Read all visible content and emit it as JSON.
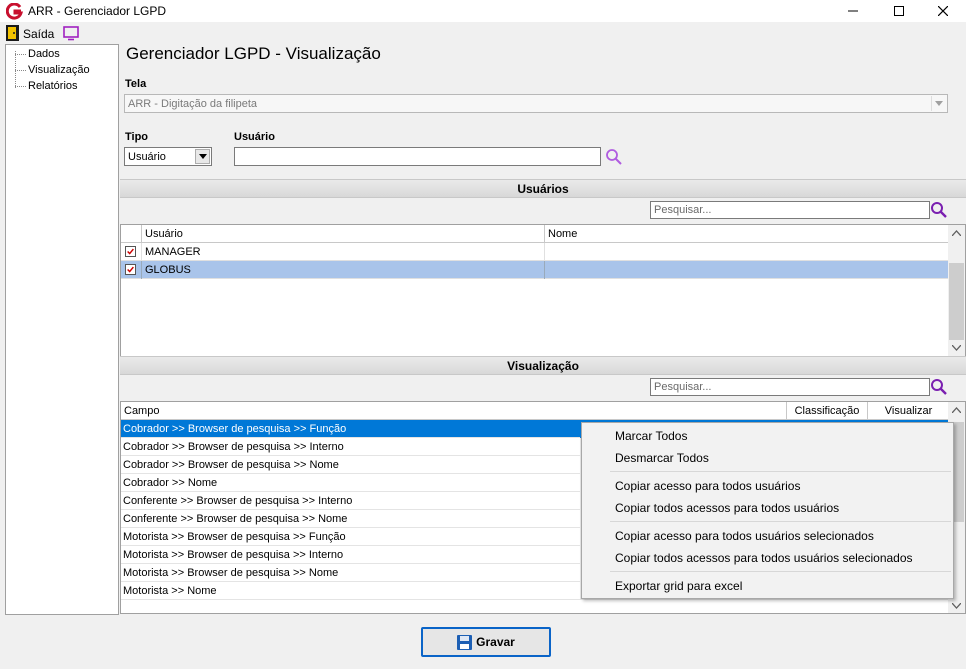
{
  "window": {
    "title": "ARR - Gerenciador LGPD"
  },
  "toolbar": {
    "exit_label": "Saída"
  },
  "tree": {
    "items": [
      "Dados",
      "Visualização",
      "Relatórios"
    ]
  },
  "page": {
    "title": "Gerenciador LGPD - Visualização"
  },
  "form": {
    "tela_label": "Tela",
    "tela_value": "ARR - Digitação da filipeta",
    "tipo_label": "Tipo",
    "tipo_value": "Usuário",
    "usuario_label": "Usuário",
    "usuario_value": ""
  },
  "users_section": {
    "title": "Usuários",
    "search_placeholder": "Pesquisar...",
    "columns": [
      "Usuário",
      "Nome"
    ],
    "rows": [
      {
        "usuario": "MANAGER",
        "nome": "",
        "checked": true
      },
      {
        "usuario": "GLOBUS",
        "nome": "",
        "checked": true
      }
    ]
  },
  "view_section": {
    "title": "Visualização",
    "search_placeholder": "Pesquisar...",
    "columns": [
      "Campo",
      "Classificação",
      "Visualizar"
    ],
    "rows": [
      "Cobrador >> Browser de pesquisa >> Função",
      "Cobrador >> Browser de pesquisa >> Interno",
      "Cobrador >> Browser de pesquisa >> Nome",
      "Cobrador >> Nome",
      "Conferente >> Browser de pesquisa >> Interno",
      "Conferente >> Browser de pesquisa >> Nome",
      "Motorista >> Browser de pesquisa >> Função",
      "Motorista >> Browser de pesquisa >> Interno",
      "Motorista >> Browser de pesquisa >> Nome",
      "Motorista >> Nome"
    ]
  },
  "context_menu": {
    "items": [
      "Marcar Todos",
      "Desmarcar Todos",
      "Copiar acesso para todos usuários",
      "Copiar todos acessos para todos usuários",
      "Copiar acesso para todos usuários selecionados",
      "Copiar todos acessos para todos usuários selecionados",
      "Exportar grid para excel"
    ]
  },
  "footer": {
    "save_label": "Gravar"
  },
  "colors": {
    "accent": "#0a64c8",
    "selected_row": "#a9c4ea",
    "highlight_row": "#0078d7",
    "search_icon": "#7a1fb0"
  }
}
